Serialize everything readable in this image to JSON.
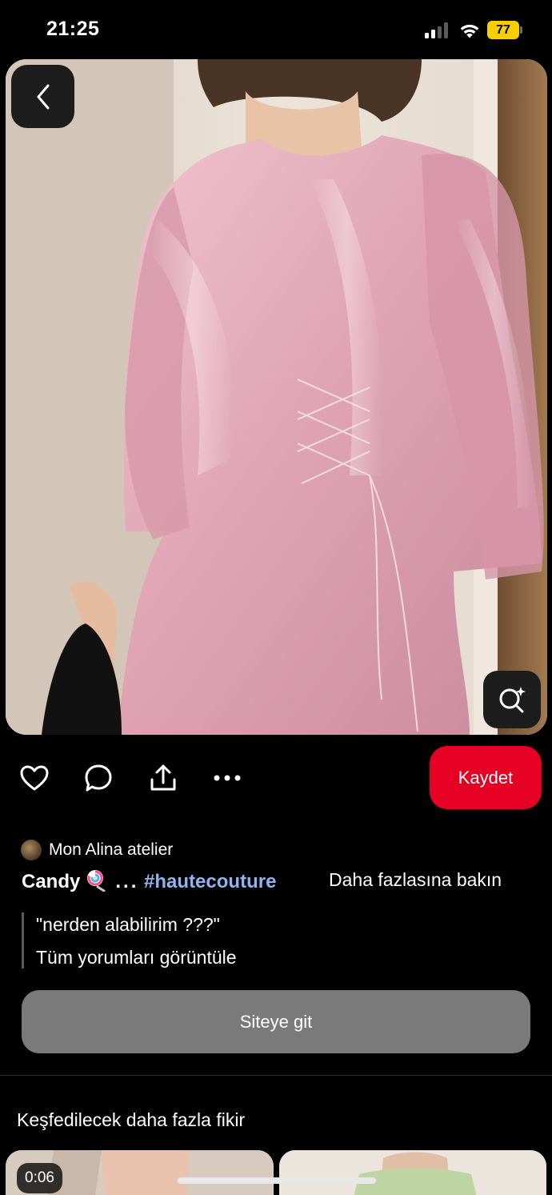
{
  "status_bar": {
    "time": "21:25",
    "battery": "77",
    "signal_bars_active": 2,
    "signal_bars_total": 4
  },
  "hero": {
    "back_icon": "chevron-left-icon",
    "lens_icon": "visual-search-icon"
  },
  "actions": {
    "like_icon": "heart-icon",
    "comment_icon": "comment-bubble-icon",
    "share_icon": "share-icon",
    "more_icon": "more-dots-icon",
    "save_label": "Kaydet"
  },
  "pin": {
    "creator_name": "Mon Alina atelier",
    "title": "Candy",
    "title_emoji": "lollipop-icon",
    "dots": "...",
    "hashtag": "#hautecouture",
    "more_label": "Daha fazlasına bakın",
    "comment": "\"nerden alabilirim ???\"",
    "view_comments": "Tüm yorumları görüntüle",
    "visit_label": "Siteye git"
  },
  "more_ideas": {
    "heading": "Keşfedilecek daha fazla fikir",
    "video_time": "0:06"
  },
  "colors": {
    "background": "#000000",
    "save_red": "#e60023",
    "hashtag_blue": "#8fb4ee",
    "visit_gray": "#7a7a7a",
    "battery_yellow": "#f7ce00",
    "dress_pink": "#e2aab9"
  }
}
